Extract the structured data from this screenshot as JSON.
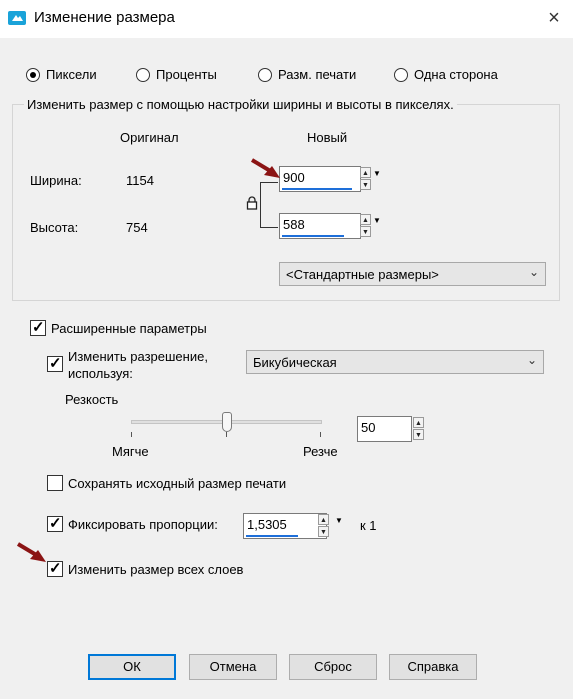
{
  "window": {
    "title": "Изменение размера",
    "close_icon": "×"
  },
  "mode": {
    "options": [
      {
        "label": "Пиксели",
        "selected": true
      },
      {
        "label": "Проценты",
        "selected": false
      },
      {
        "label": "Разм. печати",
        "selected": false
      },
      {
        "label": "Одна сторона",
        "selected": false
      }
    ]
  },
  "pixel_group": {
    "legend": "Изменить размер с помощью настройки ширины и высоты в пикселях.",
    "col_original": "Оригинал",
    "col_new": "Новый",
    "width_label": "Ширина:",
    "width_original": "1154",
    "width_new": "900",
    "height_label": "Высота:",
    "height_original": "754",
    "height_new": "588",
    "preset": "<Стандартные размеры>"
  },
  "advanced": {
    "label": "Расширенные параметры",
    "checked": true,
    "resample_label_1": "Изменить разрешение,",
    "resample_label_2": "используя:",
    "resample_checked": true,
    "resample_method": "Бикубическая",
    "sharpness_label": "Резкость",
    "softer_label": "Мягче",
    "sharper_label": "Резче",
    "sharpness_value": "50",
    "sharpness_level": 50,
    "keep_print_size_label": "Сохранять исходный размер печати",
    "keep_print_size_checked": false,
    "lock_ratio_label": "Фиксировать пропорции:",
    "lock_ratio_checked": true,
    "ratio_value": "1,5305",
    "ratio_suffix": "к 1",
    "all_layers_label": "Изменить размер всех слоев",
    "all_layers_checked": true
  },
  "buttons": {
    "ok": "ОК",
    "cancel": "Отмена",
    "reset": "Сброс",
    "help": "Справка"
  },
  "colors": {
    "accent": "#1e6fd9",
    "annotation_arrow": "#8b1414"
  }
}
